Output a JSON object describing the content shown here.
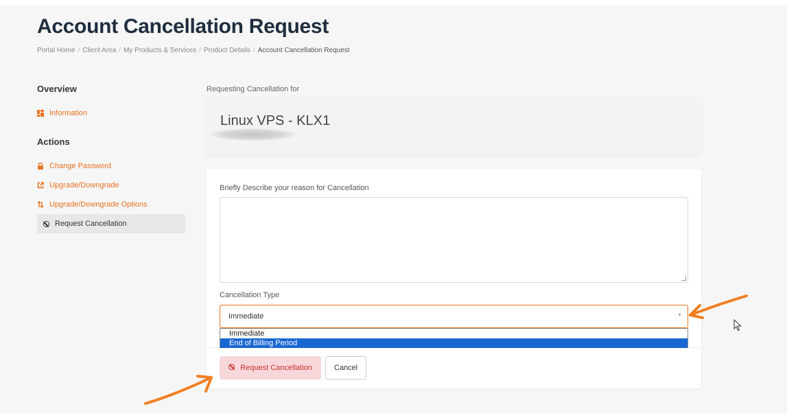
{
  "page": {
    "title": "Account Cancellation Request",
    "breadcrumb": [
      "Portal Home",
      "Client Area",
      "My Products & Services",
      "Product Details",
      "Account Cancellation Request"
    ]
  },
  "sidebar": {
    "overview_heading": "Overview",
    "overview_items": [
      {
        "label": "Information",
        "icon": "dashboard-icon"
      }
    ],
    "actions_heading": "Actions",
    "action_items": [
      {
        "label": "Change Password",
        "icon": "lock-icon"
      },
      {
        "label": "Upgrade/Downgrade",
        "icon": "external-link-icon"
      },
      {
        "label": "Upgrade/Downgrade Options",
        "icon": "sort-arrows-icon"
      },
      {
        "label": "Request Cancellation",
        "icon": "ban-icon",
        "active": true
      }
    ]
  },
  "product": {
    "requesting_label": "Requesting Cancellation for",
    "name": "Linux VPS - KLX1"
  },
  "form": {
    "reason_label": "Briefly Describe your reason for Cancellation",
    "reason_value": "",
    "type_label": "Cancellation Type",
    "type_selected": "Immediate",
    "type_options": [
      "Immediate",
      "End of Billing Period"
    ],
    "type_highlighted": "End of Billing Period",
    "submit_label": "Request Cancellation",
    "cancel_label": "Cancel"
  },
  "colors": {
    "accent": "#e8711e",
    "danger_bg": "#f8d7da",
    "danger_text": "#c9302c",
    "option_highlight": "#1967d2",
    "annotation_arrow": "#f07f23"
  }
}
